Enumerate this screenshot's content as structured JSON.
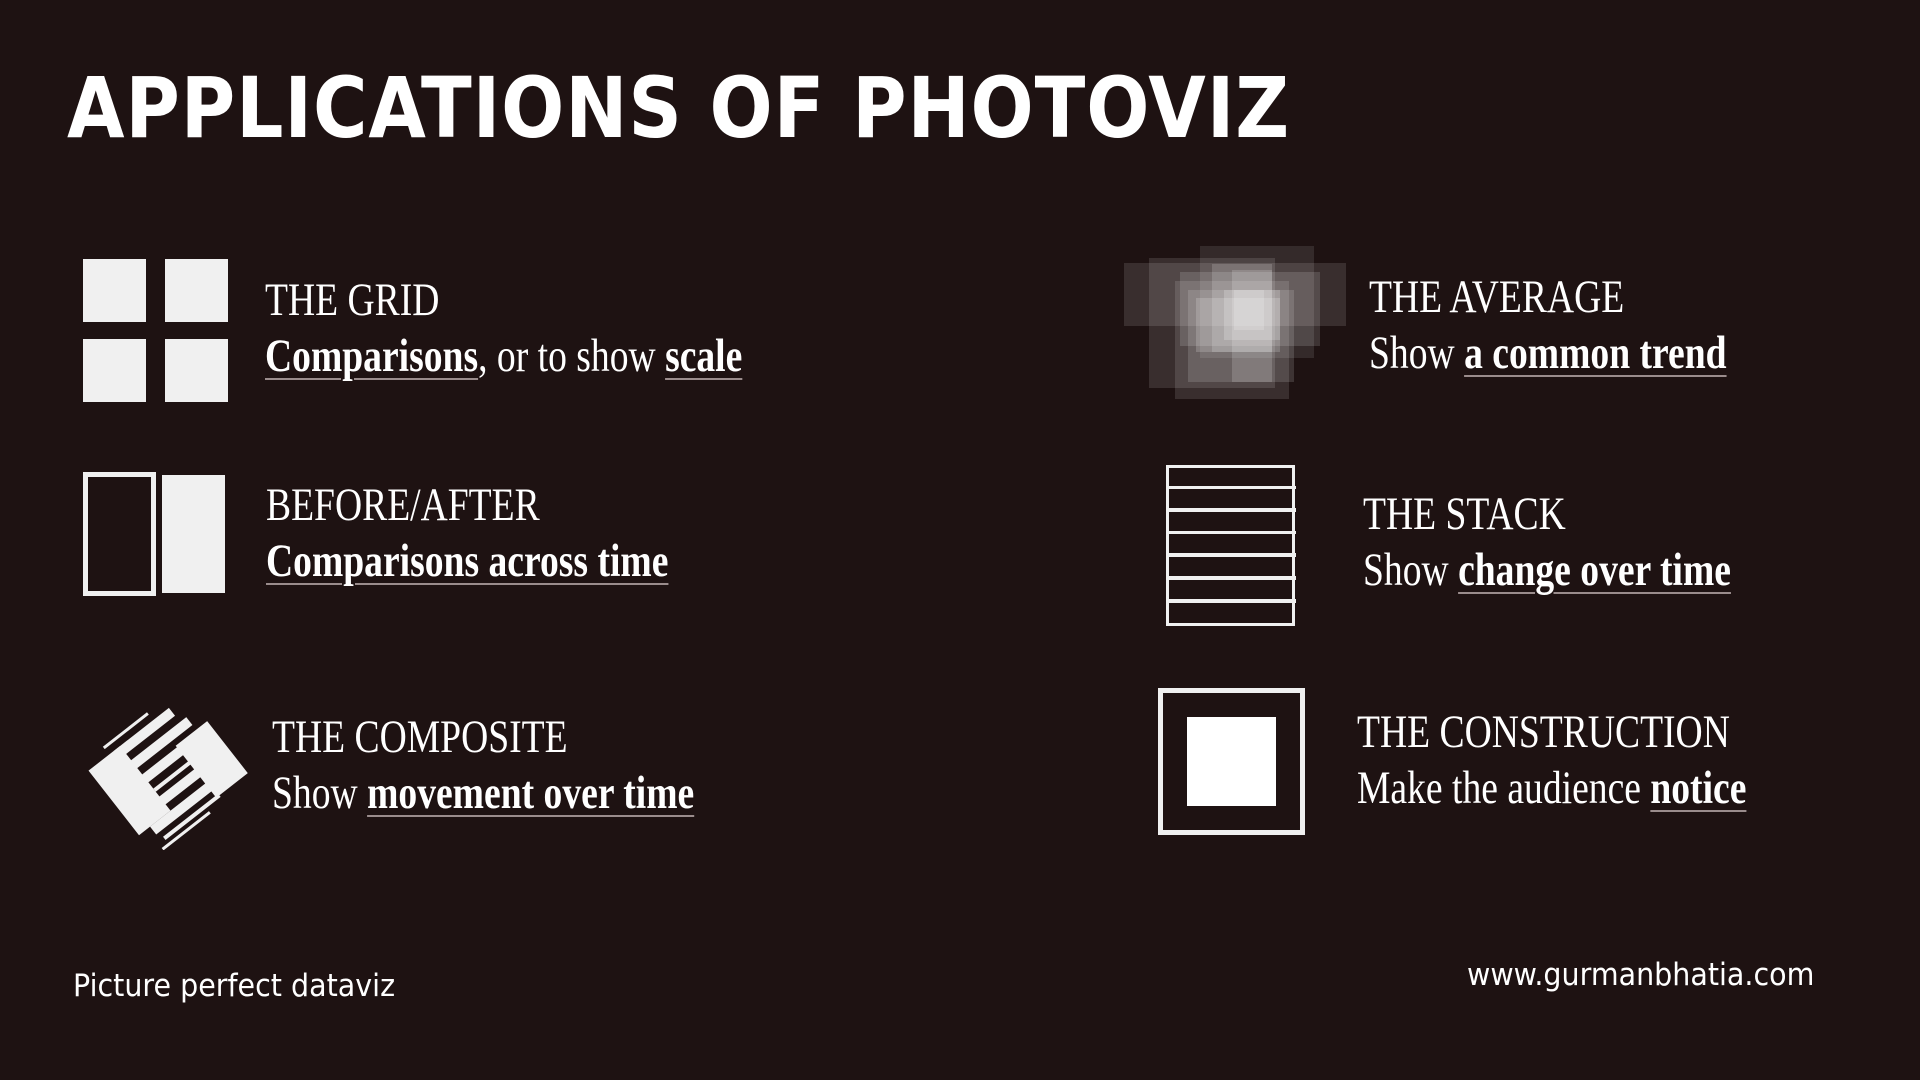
{
  "title": "Applications of Photoviz",
  "items": [
    {
      "id": "grid",
      "icon": "grid-icon",
      "heading": "THE GRID",
      "desc_parts": [
        {
          "text": "Comparisons",
          "emphasis": true
        },
        {
          "text": ", or to show ",
          "emphasis": false
        },
        {
          "text": "scale",
          "emphasis": true
        }
      ]
    },
    {
      "id": "before-after",
      "icon": "before-after-icon",
      "heading": "BEFORE/AFTER",
      "desc_parts": [
        {
          "text": "Comparisons across time",
          "emphasis": true
        }
      ]
    },
    {
      "id": "composite",
      "icon": "composite-icon",
      "heading": "THE COMPOSITE",
      "desc_parts": [
        {
          "text": "Show ",
          "emphasis": false
        },
        {
          "text": "movement over time",
          "emphasis": true
        }
      ]
    },
    {
      "id": "average",
      "icon": "average-icon",
      "heading": "THE AVERAGE",
      "desc_parts": [
        {
          "text": "Show ",
          "emphasis": false
        },
        {
          "text": "a common trend",
          "emphasis": true
        }
      ]
    },
    {
      "id": "stack",
      "icon": "stack-icon",
      "heading": "THE STACK",
      "desc_parts": [
        {
          "text": "Show ",
          "emphasis": false
        },
        {
          "text": "change over time",
          "emphasis": true
        }
      ]
    },
    {
      "id": "construction",
      "icon": "construction-icon",
      "heading": "THE CONSTRUCTION",
      "desc_parts": [
        {
          "text": "Make the audience ",
          "emphasis": false
        },
        {
          "text": "notice",
          "emphasis": true
        }
      ]
    }
  ],
  "footer": {
    "tagline": "Picture perfect dataviz",
    "website": "www.gurmanbhatia.com"
  },
  "colors": {
    "background": "#1e1212",
    "foreground": "#f0f0f0",
    "underline": "#9a8c8c"
  }
}
